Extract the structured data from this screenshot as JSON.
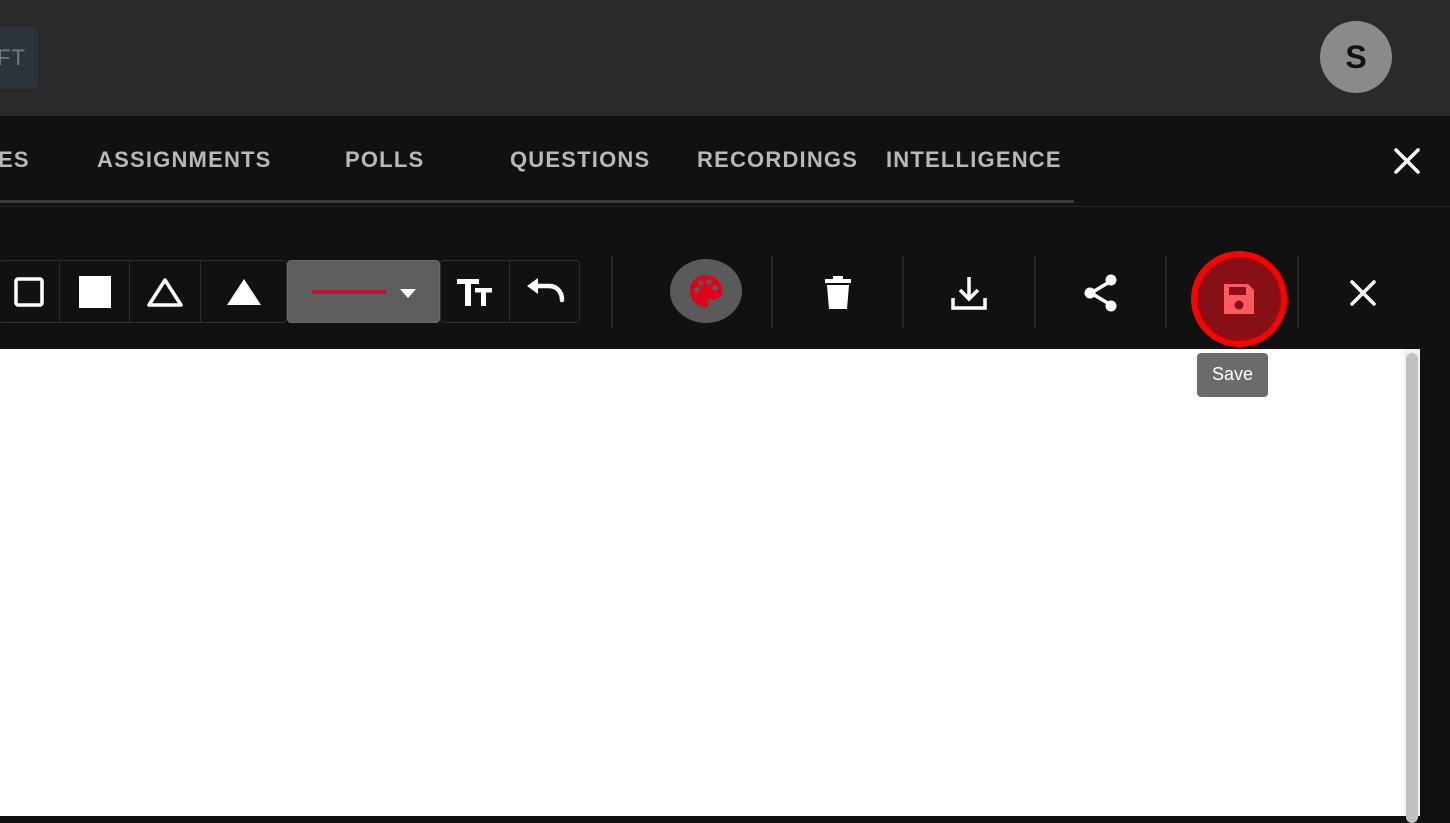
{
  "header": {
    "left_chip_text": "FT",
    "avatar_initial": "S"
  },
  "tabs": [
    {
      "label": "ES"
    },
    {
      "label": "ASSIGNMENTS"
    },
    {
      "label": "POLLS"
    },
    {
      "label": "QUESTIONS"
    },
    {
      "label": "RECORDINGS"
    },
    {
      "label": "INTELLIGENCE"
    }
  ],
  "toolbar": {
    "tools": [
      {
        "name": "rectangle-outline-icon"
      },
      {
        "name": "rectangle-filled-icon"
      },
      {
        "name": "triangle-outline-icon"
      },
      {
        "name": "triangle-filled-icon"
      }
    ],
    "stroke_color": "#c8102e",
    "actions": [
      "text-size-icon",
      "undo-icon",
      "palette-icon",
      "delete-icon",
      "download-icon",
      "share-icon",
      "save-icon",
      "close-icon"
    ],
    "save_tooltip": "Save"
  },
  "colors": {
    "accent_red": "#ff0000",
    "save_fill": "#8d0e13",
    "palette_icon": "#e0001b"
  }
}
